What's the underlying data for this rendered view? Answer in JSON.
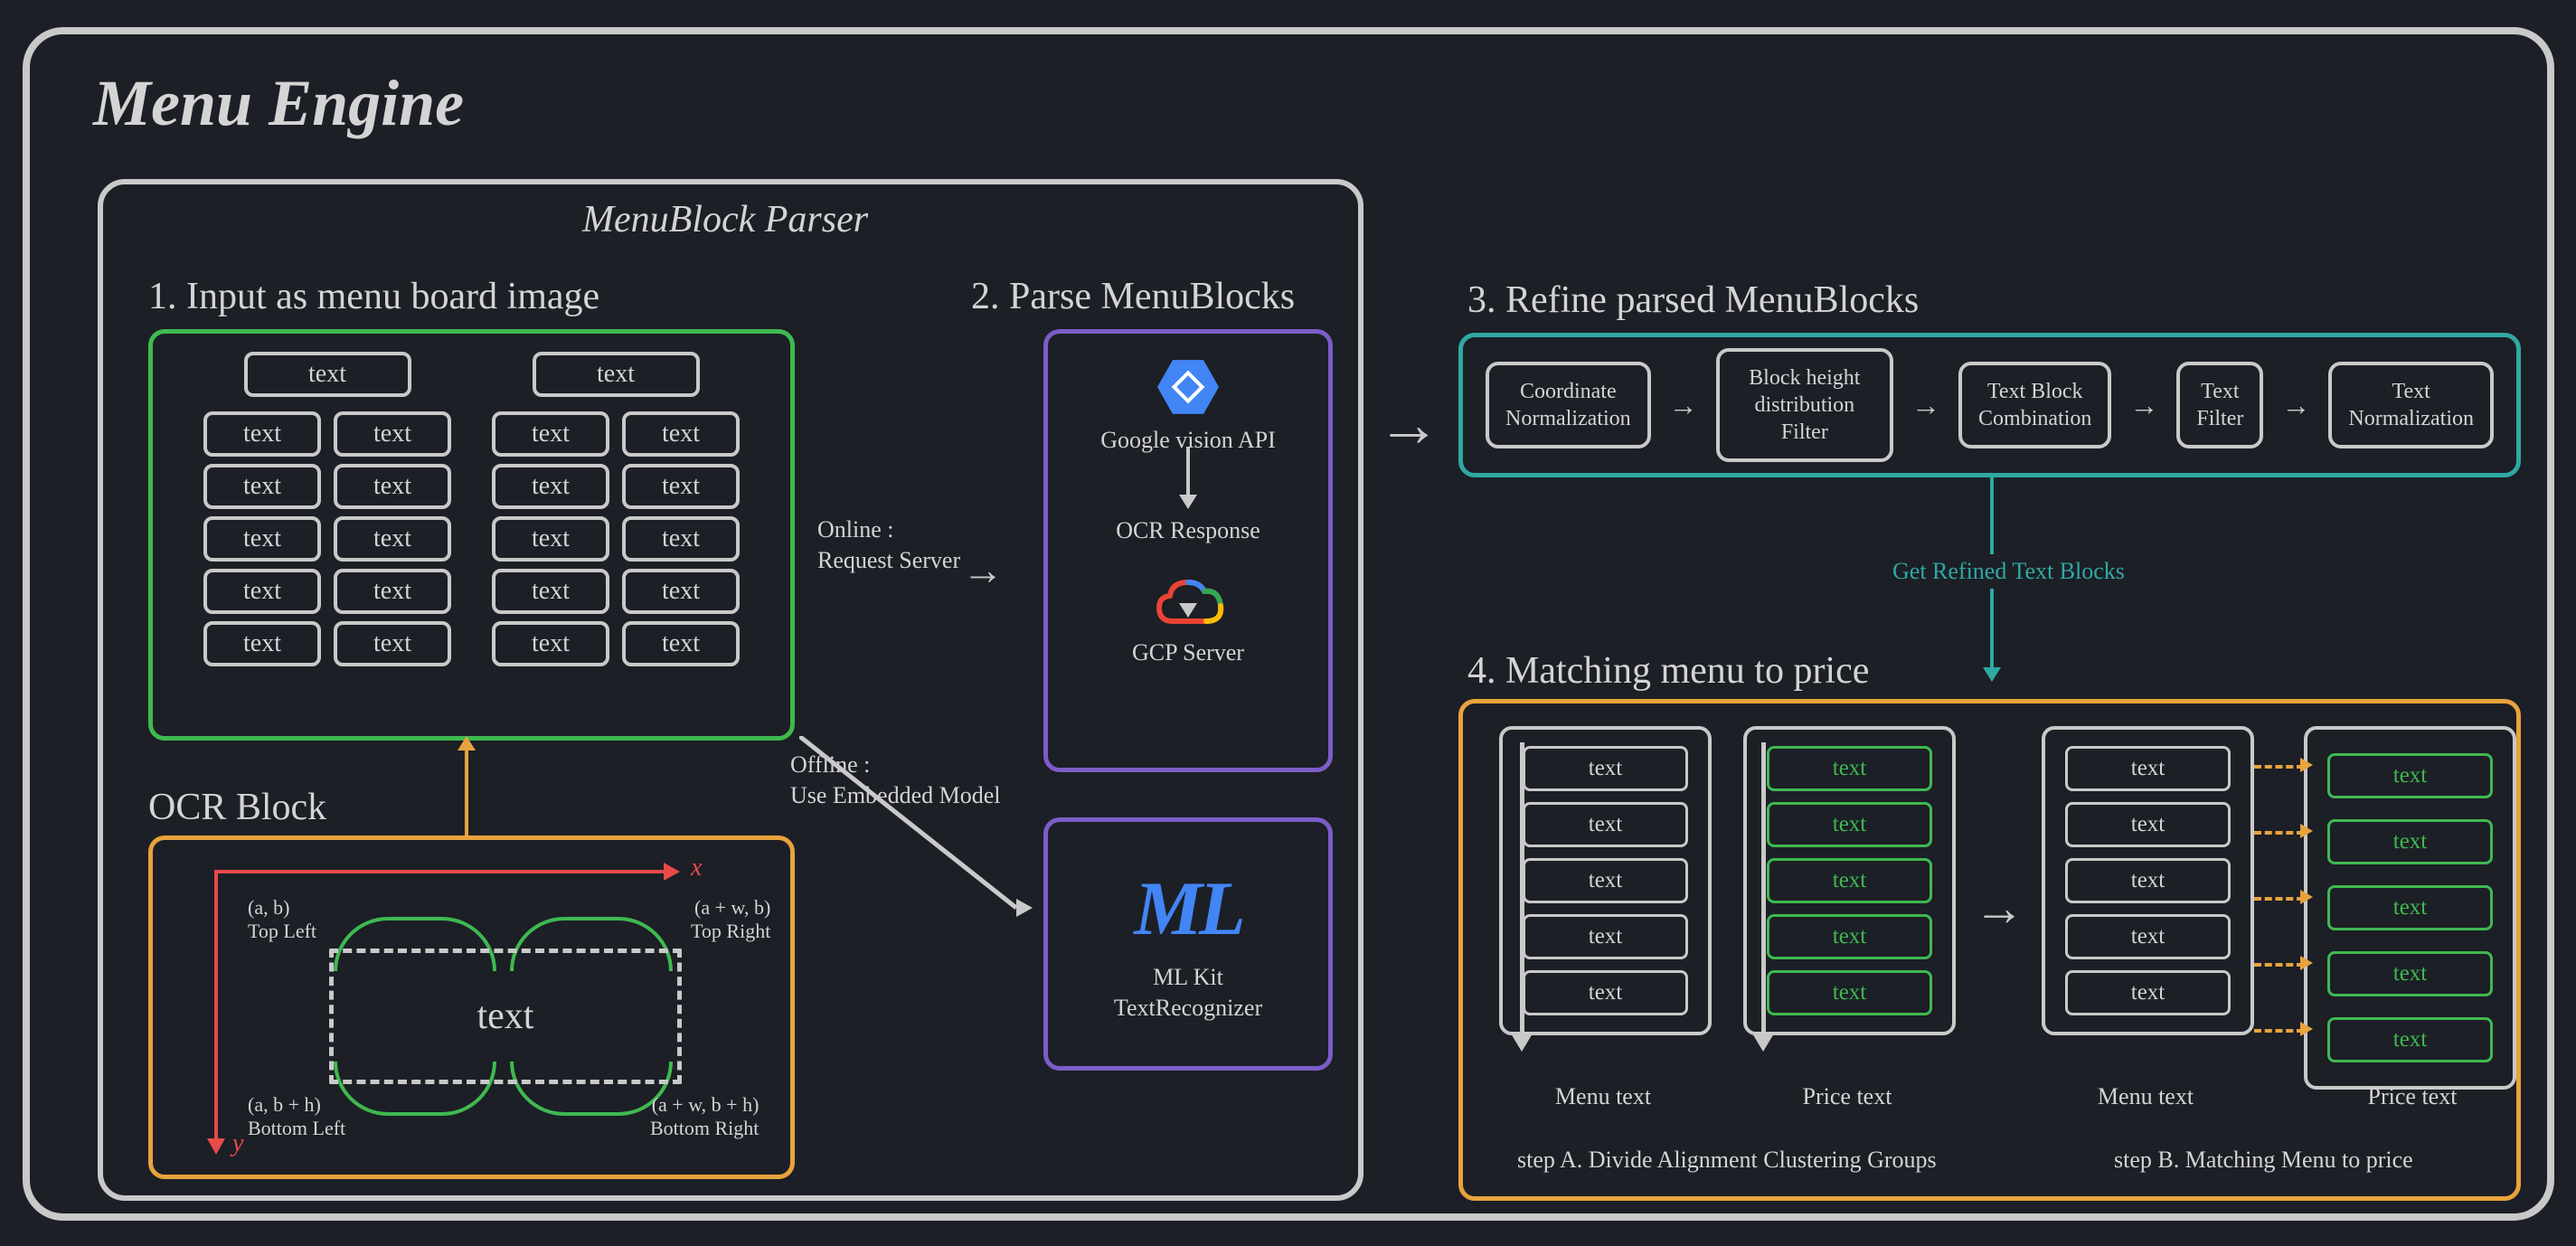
{
  "title": "Menu Engine",
  "parser": {
    "title": "MenuBlock Parser",
    "section1": {
      "title": "1. Input as menu board image",
      "cell": "text"
    },
    "section2": {
      "title": "2. Parse MenuBlocks",
      "vision_label": "Google vision API",
      "ocr_response": "OCR Response",
      "gcp_label": "GCP Server",
      "mlkit_label": "ML Kit\nTextRecognizer"
    },
    "online_label": "Online :\nRequest Server",
    "offline_label": "Offline :\nUse Embedded Model",
    "ocr": {
      "title": "OCR Block",
      "center": "text",
      "x_axis": "x",
      "y_axis": "y",
      "tl": "(a, b)\nTop Left",
      "tr": "(a + w, b)\nTop Right",
      "bl": "(a, b + h)\nBottom Left",
      "br": "(a + w, b + h)\nBottom Right"
    }
  },
  "section3": {
    "title": "3. Refine parsed MenuBlocks",
    "steps": [
      "Coordinate\nNormalization",
      "Block height distribution\nFilter",
      "Text Block\nCombination",
      "Text\nFilter",
      "Text\nNormalization"
    ],
    "down_label": "Get Refined Text Blocks"
  },
  "section4": {
    "title": "4. Matching menu to price",
    "cell": "text",
    "cell_green": "text",
    "menu_caption": "Menu text",
    "price_caption": "Price text",
    "step_a": "step A. Divide Alignment Clustering Groups",
    "step_b": "step B. Matching Menu to price"
  }
}
